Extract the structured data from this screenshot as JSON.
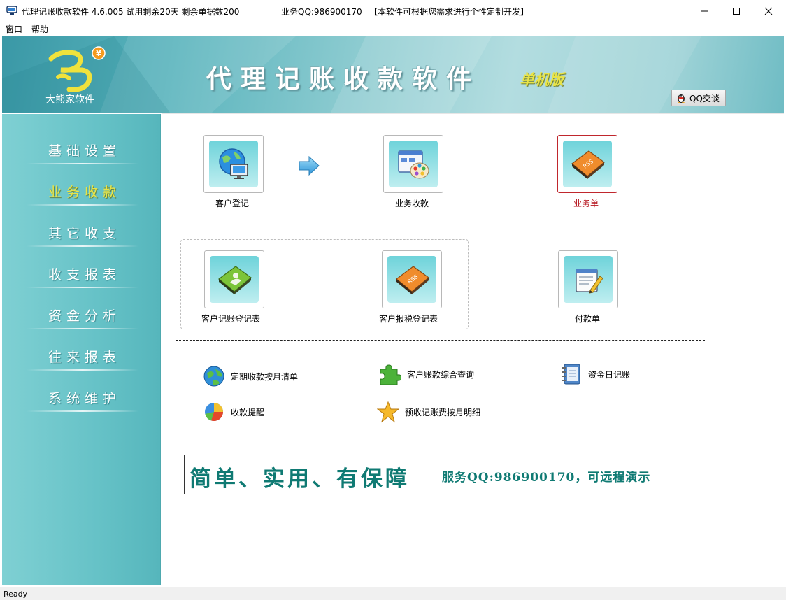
{
  "window": {
    "title": "代理记账收款软件 4.6.005  试用剩余20天  剩余单据数200",
    "service_qq": "业务QQ:986900170",
    "note": "【本软件可根据您需求进行个性定制开发】",
    "controls": {
      "minimize": "minimize-icon",
      "maximize": "maximize-icon",
      "close": "close-icon"
    }
  },
  "menu": {
    "items": [
      "窗口",
      "帮助"
    ]
  },
  "banner": {
    "logo_caption": "大熊家软件",
    "title": "代理记账收款软件",
    "edition": "单机版",
    "qq_button": "QQ交谈"
  },
  "sidebar": {
    "items": [
      {
        "label": "基础设置",
        "active": false
      },
      {
        "label": "业务收款",
        "active": true
      },
      {
        "label": "其它收支",
        "active": false
      },
      {
        "label": "收支报表",
        "active": false
      },
      {
        "label": "资金分析",
        "active": false
      },
      {
        "label": "往来报表",
        "active": false
      },
      {
        "label": "系统维护",
        "active": false
      }
    ]
  },
  "tiles": {
    "customer_register": {
      "label": "客户登记",
      "icon": "computer-globe-icon"
    },
    "business_receipt": {
      "label": "业务收款",
      "icon": "palette-window-icon"
    },
    "business_order": {
      "label": "业务单",
      "icon": "rss-book-icon",
      "selected": true
    },
    "bookkeeping_register": {
      "label": "客户记账登记表",
      "icon": "user-book-icon"
    },
    "tax_register": {
      "label": "客户报税登记表",
      "icon": "rss-book-icon"
    },
    "payment_order": {
      "label": "付款单",
      "icon": "notepad-pencil-icon"
    }
  },
  "links": {
    "monthly_list": {
      "label": "定期收款按月清单",
      "icon": "globe-icon"
    },
    "account_query": {
      "label": "客户账款综合查询",
      "icon": "puzzle-icon"
    },
    "cash_journal": {
      "label": "资金日记账",
      "icon": "notebook-icon"
    },
    "reminder": {
      "label": "收款提醒",
      "icon": "pie-chart-icon"
    },
    "prepaid_detail": {
      "label": "预收记账费按月明细",
      "icon": "star-icon"
    }
  },
  "slogan": {
    "main": "简单、实用、有保障",
    "sub": "服务QQ:986900170，可远程演示"
  },
  "status": {
    "text": "Ready"
  },
  "colors": {
    "sidebar": "#66c2c7",
    "active_item": "#e9e447",
    "slogan": "#0f7a73",
    "selected_border": "#c0272d"
  }
}
